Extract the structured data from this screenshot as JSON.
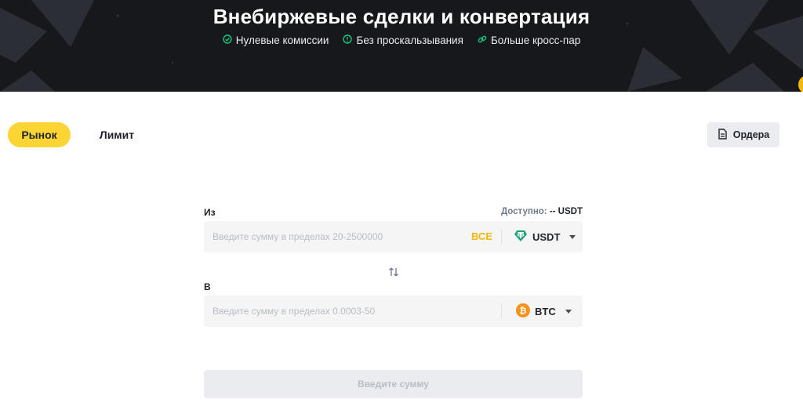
{
  "hero": {
    "title": "Внебиржевые сделки и конвертация",
    "features": [
      {
        "label": "Нулевые комиссии",
        "icon": "check-circle-icon"
      },
      {
        "label": "Без проскальзывания",
        "icon": "exclamation-circle-icon"
      },
      {
        "label": "Больше кросс-пар",
        "icon": "link-icon"
      }
    ]
  },
  "tabs": {
    "market": "Рынок",
    "limit": "Лимит",
    "active": "market"
  },
  "orders_button": {
    "label": "Ордера",
    "icon": "document-icon"
  },
  "from": {
    "label": "Из",
    "available_label": "Доступно:",
    "available_value": "-- USDT",
    "placeholder": "Введите сумму в пределах 20-2500000",
    "all_label": "ВСЕ",
    "coin": "USDT",
    "coin_icon": "tether-icon"
  },
  "swap_icon": "swap-vertical-icon",
  "to": {
    "label": "В",
    "placeholder": "Введите сумму в пределах 0.0003-50",
    "coin": "BTC",
    "coin_icon": "bitcoin-icon"
  },
  "submit": {
    "label": "Введите сумму"
  },
  "colors": {
    "brand_yellow": "#fcd535",
    "accent_gold": "#f0b90b",
    "feature_green": "#0ecb81",
    "tether_green": "#26a17b",
    "bitcoin_orange": "#f7931a"
  }
}
